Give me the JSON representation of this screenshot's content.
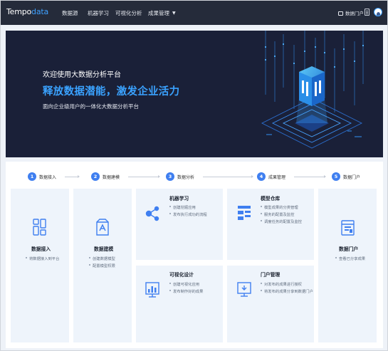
{
  "app": {
    "logo_main": "Tempo",
    "logo_accent": "data"
  },
  "nav": {
    "items": [
      {
        "label": "数据源"
      },
      {
        "label": "机器学习"
      },
      {
        "label": "可视化分析"
      },
      {
        "label": "成果管理"
      }
    ],
    "portal_label": "数据门户"
  },
  "hero": {
    "line1": "欢迎使用大数据分析平台",
    "line2": "释放数据潜能，激发企业活力",
    "line3": "面向企业级用户的一体化大数据分析平台"
  },
  "steps": [
    {
      "num": "1",
      "label": "数据接入"
    },
    {
      "num": "2",
      "label": "数据建模"
    },
    {
      "num": "3",
      "label": "数据分析"
    },
    {
      "num": "4",
      "label": "成果管理"
    },
    {
      "num": "5",
      "label": "数据门户"
    }
  ],
  "cards": {
    "ingest": {
      "title": "数据接入",
      "bullets": [
        "将数据接入到平台"
      ]
    },
    "model": {
      "title": "数据建模",
      "bullets": [
        "创建数据模型",
        "配置模型权限"
      ]
    },
    "ml": {
      "title": "机器学习",
      "bullets": [
        "创建挖掘应用",
        "发布执行成功的流程"
      ]
    },
    "warehouse": {
      "title": "模型仓库",
      "bullets": [
        "模型成果的分类管理",
        "服务的配置及监控",
        "调度任务的配置及监控"
      ]
    },
    "viz": {
      "title": "可视化设计",
      "bullets": [
        "创建可视化应用",
        "发布制作好的成果"
      ]
    },
    "portalmgr": {
      "title": "门户管理",
      "bullets": [
        "对发布的成果进行授权",
        "将发布的成果分享到数据门户"
      ]
    },
    "portal": {
      "title": "数据门户",
      "bullets": [
        "查看已分享成果"
      ]
    }
  },
  "colors": {
    "accent": "#3f7ff0",
    "nav_bg": "#252b3a",
    "hero_bg": "#1a2038",
    "hero_highlight": "#3aa2ff",
    "card_bg": "#eef4fb"
  }
}
